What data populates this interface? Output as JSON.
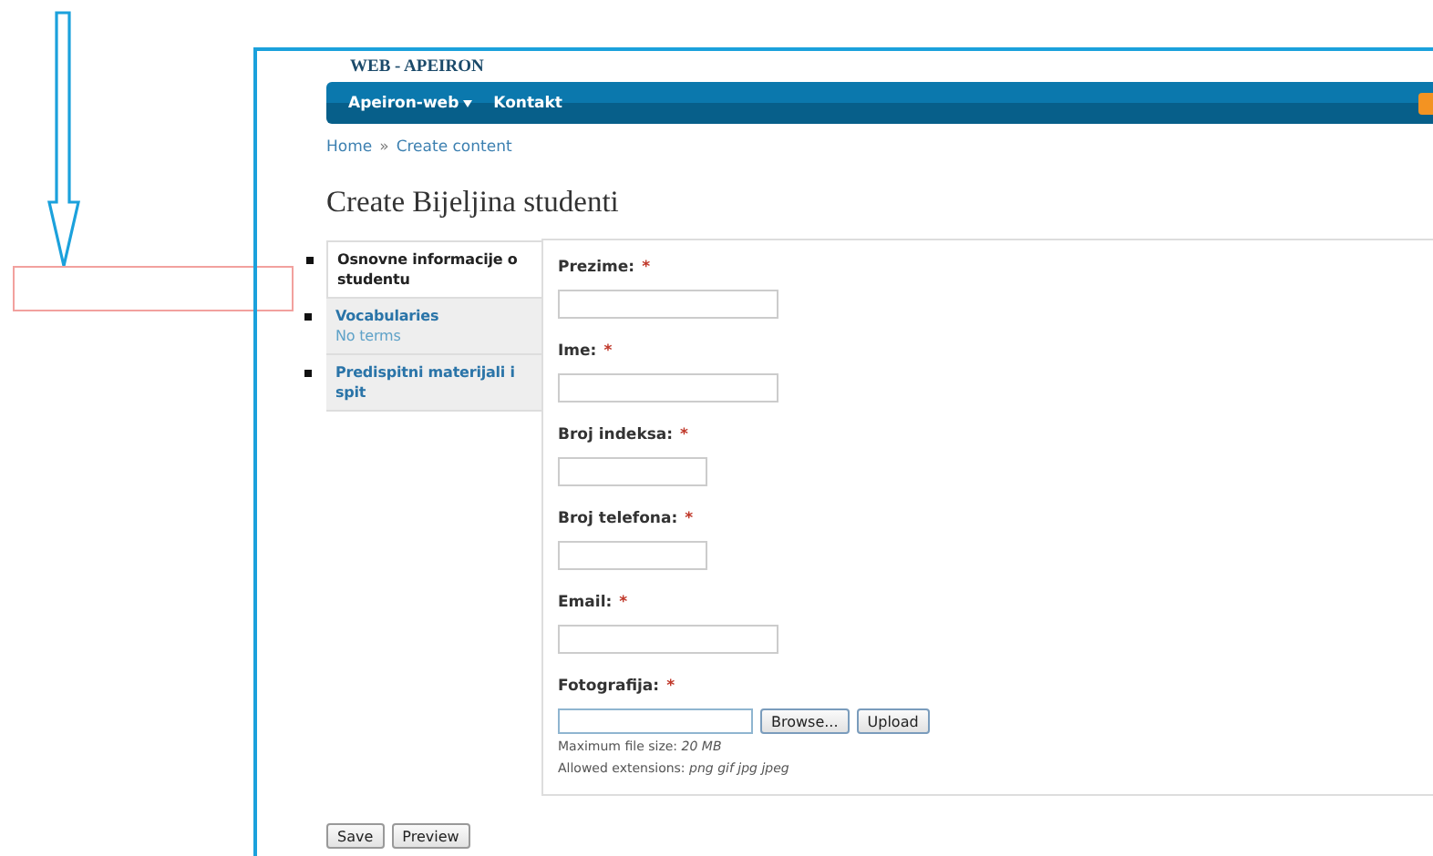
{
  "site": {
    "name": "WEB - APEIRON"
  },
  "nav": [
    {
      "label": "Apeiron-web",
      "has_menu": true
    },
    {
      "label": "Kontakt",
      "has_menu": false
    }
  ],
  "breadcrumb": [
    {
      "label": "Home"
    },
    {
      "label": "»"
    },
    {
      "label": "Create content"
    }
  ],
  "page_title": "Create Bijeljina studenti",
  "vertical_tabs": [
    {
      "label": "Osnovne informacije o studentu",
      "selected": true
    },
    {
      "label": "Vocabularies",
      "summary": "No terms",
      "selected": false
    },
    {
      "label": "Predispitni materijali i spit",
      "selected": false
    }
  ],
  "fields": [
    {
      "kind": "text",
      "label": "Prezime:",
      "required_mark": "*"
    },
    {
      "kind": "text",
      "label": "Ime:",
      "required_mark": "*"
    },
    {
      "kind": "number",
      "label": "Broj indeksa:",
      "required_mark": "*"
    },
    {
      "kind": "number",
      "label": "Broj telefona:",
      "required_mark": "*"
    },
    {
      "kind": "text",
      "label": "Email:",
      "required_mark": "*"
    },
    {
      "kind": "file",
      "label": "Fotografija:",
      "required_mark": "*",
      "browse": "Browse...",
      "upload": "Upload",
      "descriptions": [
        "Maximum file size: *20 MB*",
        "Allowed extensions: *png gif jpg jpeg*"
      ]
    }
  ],
  "actions": [
    "Save",
    "Preview"
  ]
}
